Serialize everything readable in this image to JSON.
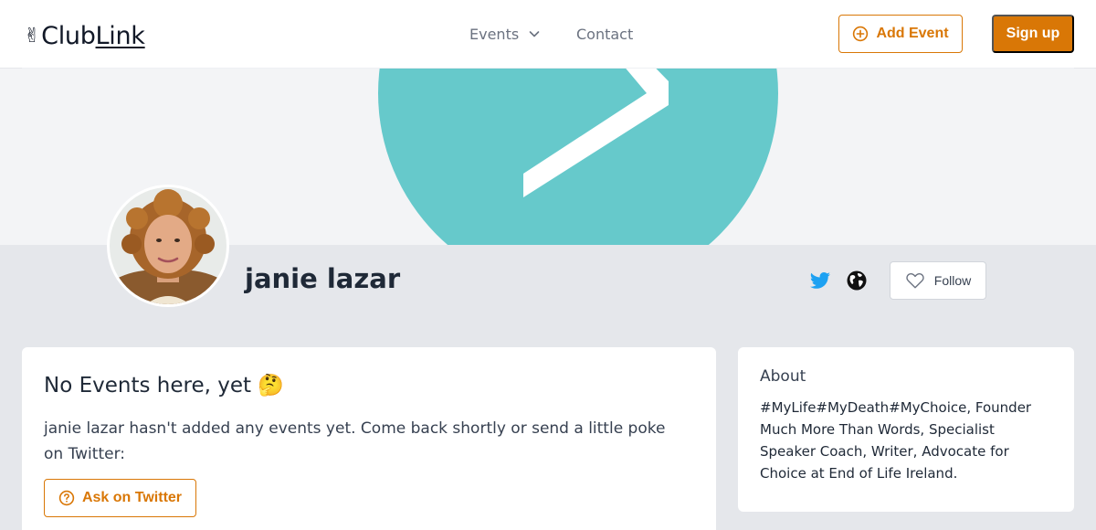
{
  "logo": {
    "emoji": "✌",
    "text_a": "Club",
    "text_b": "Link"
  },
  "nav": {
    "events_label": "Events",
    "contact_label": "Contact"
  },
  "header_actions": {
    "add_event_label": "Add Event",
    "signup_label": "Sign up"
  },
  "profile": {
    "name": "janie lazar",
    "follow_label": "Follow",
    "links": [
      "twitter-icon",
      "globe-icon"
    ]
  },
  "events_card": {
    "title": "No Events here, yet 🤔",
    "message": "janie lazar hasn't added any events yet. Come back shortly or send a little poke on Twitter:",
    "ask_label": "Ask on Twitter"
  },
  "about_card": {
    "title": "About",
    "text": "#MyLife#MyDeath#MyChoice, Founder Much More Than Words, Specialist Speaker Coach, Writer, Advocate for Choice at End of Life Ireland."
  },
  "colors": {
    "accent": "#d97706",
    "banner_circle": "#66c9cb",
    "twitter": "#1da1f2",
    "page_bg": "#e5e7eb"
  }
}
